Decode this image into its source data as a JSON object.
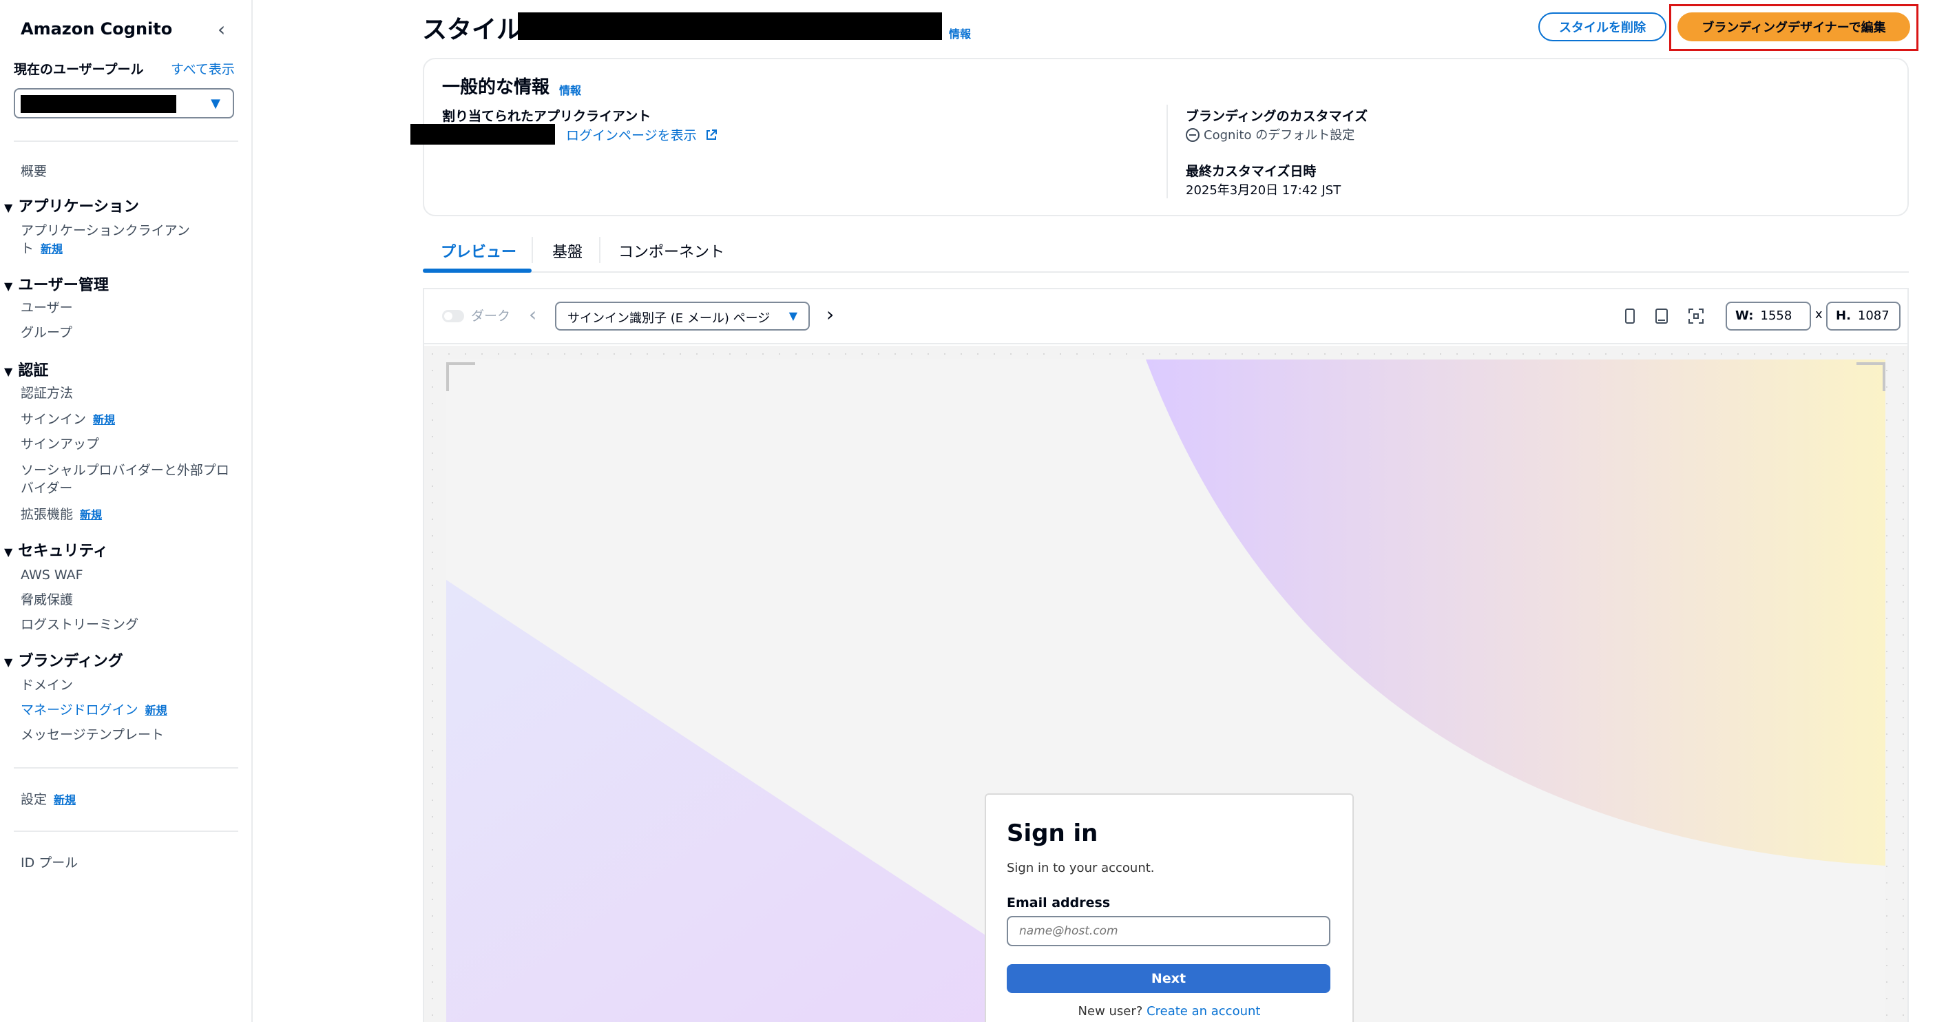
{
  "sidebar": {
    "title": "Amazon Cognito",
    "pool_label": "現在のユーザープール",
    "show_all": "すべて表示",
    "overview": "概要",
    "groups": {
      "applications": "アプリケーション",
      "user_management": "ユーザー管理",
      "auth": "認証",
      "security": "セキュリティ",
      "branding": "ブランディング"
    },
    "items": {
      "app_client_1": "アプリケーションクライアン",
      "app_client_2": "ト",
      "users": "ユーザー",
      "groups": "グループ",
      "auth_methods": "認証方法",
      "sign_in": "サインイン",
      "sign_up": "サインアップ",
      "social_1": "ソーシャルプロバイダーと外部プロ",
      "social_2": "バイダー",
      "extensions": "拡張機能",
      "aws_waf": "AWS WAF",
      "threat_protection": "脅威保護",
      "log_streaming": "ログストリーミング",
      "domain": "ドメイン",
      "managed_login": "マネージドログイン",
      "message_templates": "メッセージテンプレート",
      "settings": "設定",
      "identity_pools": "ID プール"
    },
    "new_badge": "新規"
  },
  "header": {
    "title": "スタイル:",
    "info": "情報",
    "delete_button": "スタイルを削除",
    "edit_button": "ブランディングデザイナーで編集"
  },
  "info_card": {
    "title": "一般的な情報",
    "info": "情報",
    "app_client_label": "割り当てられたアプリクライアント",
    "view_login_link": "ログインページを表示",
    "branding_label": "ブランディングのカスタマイズ",
    "branding_value": "Cognito のデフォルト設定",
    "last_modified_label": "最終カスタマイズ日時",
    "last_modified_value": "2025年3月20日 17:42 JST"
  },
  "tabs": {
    "preview": "プレビュー",
    "foundation": "基盤",
    "components": "コンポーネント"
  },
  "preview": {
    "dark_label": "ダーク",
    "page_select": "サインイン識別子 (E メール) ページ",
    "width_label": "W:",
    "width_value": "1558",
    "x": "x",
    "height_label": "H.",
    "height_value": "1087"
  },
  "signin": {
    "title": "Sign in",
    "subtitle": "Sign in to your account.",
    "email_label": "Email address",
    "email_placeholder": "name@host.com",
    "next_button": "Next",
    "new_user": "New user?",
    "create_account": "Create an account"
  },
  "colors": {
    "accent": "#0972d3",
    "primary_button": "#f59e2e",
    "highlight": "#d91515",
    "signin_button": "#2f6fd0"
  }
}
